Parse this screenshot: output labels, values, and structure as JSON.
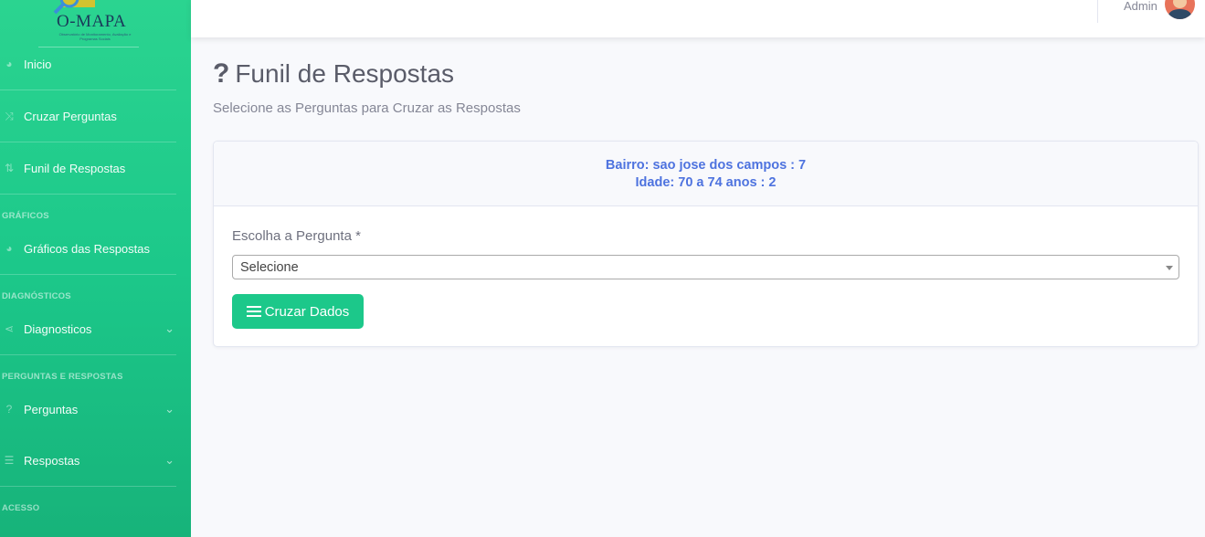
{
  "brand": {
    "name": "O-MAPA",
    "sub": "Observatório de Monitoramento, Avaliação e Programas Sociais"
  },
  "sidebar": {
    "items": [
      {
        "label": "Inicio",
        "icon": "tachometer-icon"
      },
      {
        "label": "Cruzar Perguntas",
        "icon": "random-icon"
      },
      {
        "label": "Funil de Respostas",
        "icon": "sort-icon"
      },
      {
        "label": "Gráficos das Respostas",
        "icon": "tachometer-icon"
      },
      {
        "label": "Diagnosticos",
        "icon": "share-icon"
      },
      {
        "label": "Perguntas",
        "icon": "question-icon"
      },
      {
        "label": "Respostas",
        "icon": "list-icon"
      }
    ],
    "headings": {
      "graficos": "GRÁFICOS",
      "diagnosticos": "DIAGNÓSTICOS",
      "perguntas": "PERGUNTAS E RESPOSTAS",
      "acesso": "ACESSO"
    }
  },
  "topbar": {
    "user": "Admin"
  },
  "page": {
    "title": "Funil de Respostas",
    "subtitle": "Selecione as Perguntas para Cruzar as Respostas"
  },
  "card": {
    "filters": [
      "Bairro: sao jose dos campos : 7",
      "Idade: 70 a 74 anos : 2"
    ],
    "field_label": "Escolha a Pergunta *",
    "select_value": "Selecione",
    "button": "Cruzar Dados"
  }
}
